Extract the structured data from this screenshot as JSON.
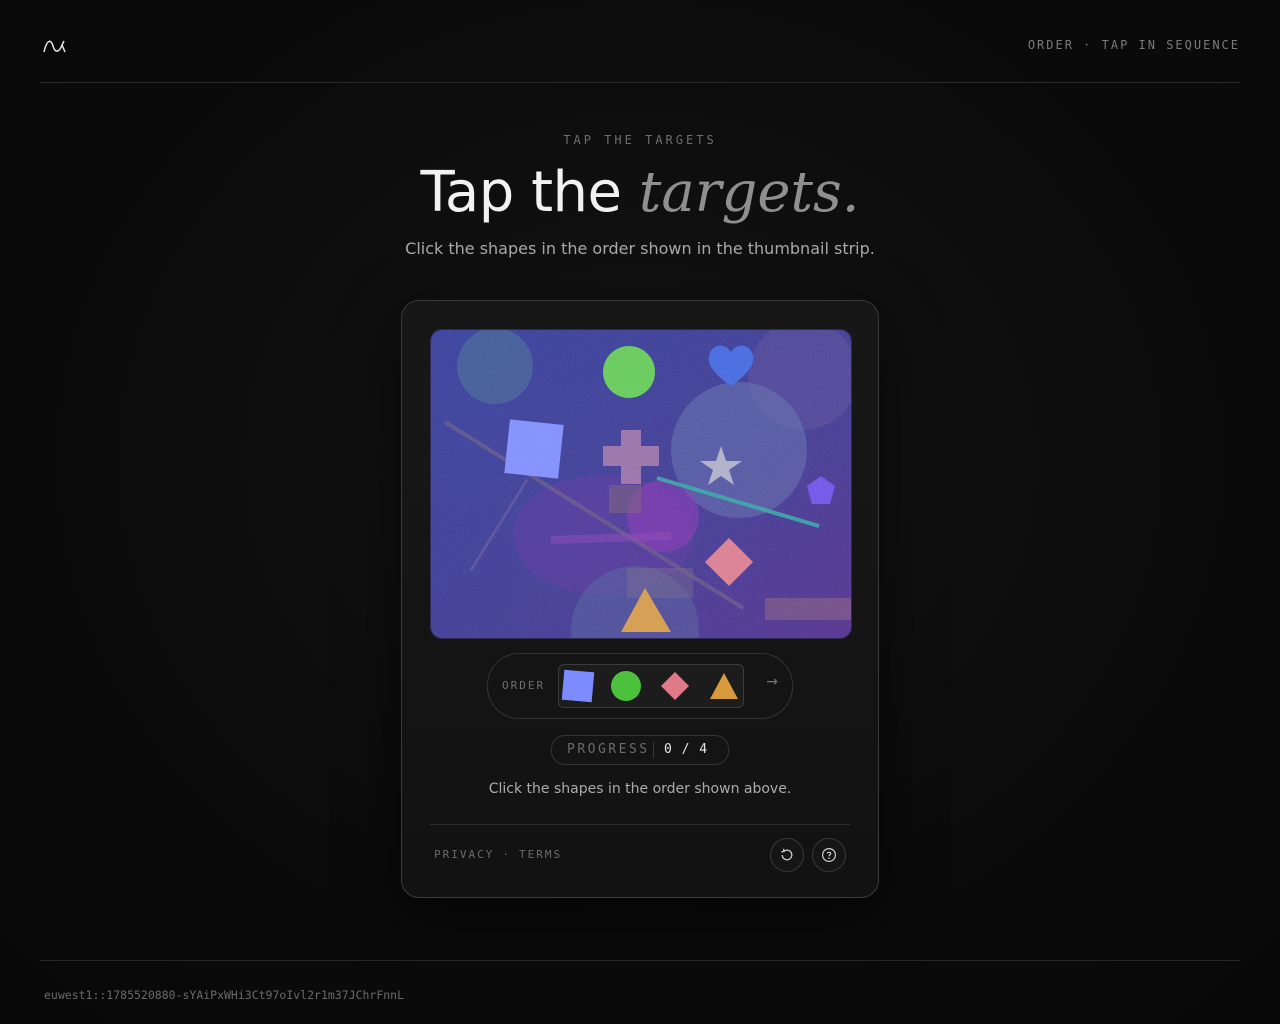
{
  "header": {
    "logo_icon": "wave-logo-icon",
    "tag": "ORDER · TAP IN SEQUENCE"
  },
  "hero": {
    "eyebrow": "TAP THE TARGETS",
    "title_main": "Tap the",
    "title_accent": "targets.",
    "subtitle": "Click the shapes in the order shown in the thumbnail strip."
  },
  "challenge": {
    "canvas_shapes": [
      {
        "shape": "circle",
        "color": "#5ecf4a"
      },
      {
        "shape": "heart",
        "color": "#3a63e0"
      },
      {
        "shape": "square",
        "color": "#7c8cff"
      },
      {
        "shape": "cross",
        "color": "#b07ca8"
      },
      {
        "shape": "star",
        "color": "#a6a6b8"
      },
      {
        "shape": "pentagon",
        "color": "#6a4ae8"
      },
      {
        "shape": "diamond",
        "color": "#e07a88"
      },
      {
        "shape": "triangle",
        "color": "#d99a3c"
      }
    ],
    "order_label": "ORDER",
    "order_sequence": [
      {
        "shape": "square",
        "color": "#7c8cff",
        "name": "thumb-square-icon"
      },
      {
        "shape": "circle",
        "color": "#4cc23c",
        "name": "thumb-circle-icon"
      },
      {
        "shape": "diamond",
        "color": "#e07a88",
        "name": "thumb-diamond-icon"
      },
      {
        "shape": "triangle",
        "color": "#d99a3c",
        "name": "thumb-triangle-icon"
      }
    ],
    "next_icon": "arrow-right-icon",
    "next_glyph": "→",
    "progress_label": "PROGRESS",
    "progress_value": "0 / 4",
    "progress_done": 0,
    "progress_total": 4,
    "instruction": "Click the shapes in the order shown above."
  },
  "card_footer": {
    "privacy": "PRIVACY",
    "separator": "·",
    "terms": "TERMS",
    "reload_icon": "reload-icon",
    "help_icon": "help-icon"
  },
  "footer": {
    "session_id": "euwest1::1785520880-sYAiPxWHi3Ct97oIvl2r1m37JChrFnnL"
  },
  "colors": {
    "background": "#0b0b0b",
    "card_border": "#3a3a3a",
    "canvas_base": "#2b2f8a",
    "canvas_purple": "#5a2d8a"
  }
}
